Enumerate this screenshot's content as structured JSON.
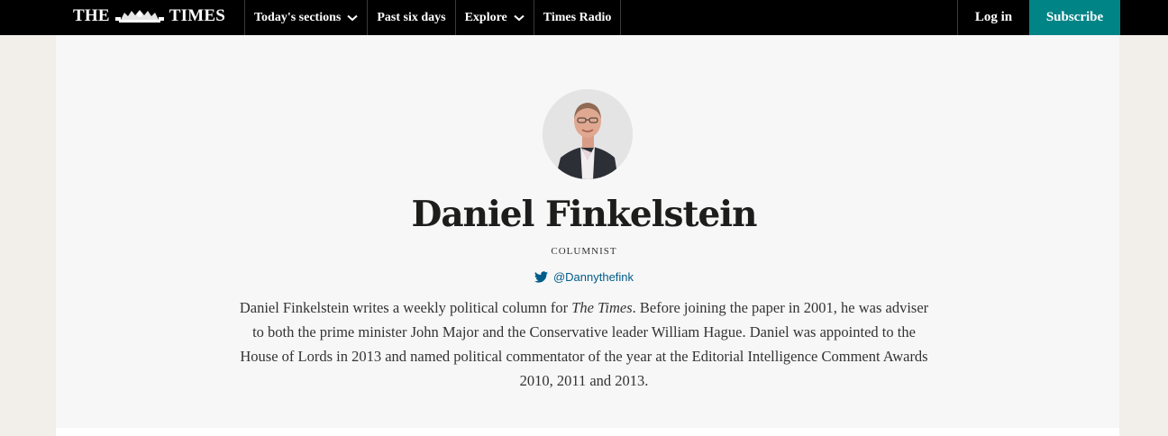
{
  "header": {
    "logo_left": "THE",
    "logo_right": "TIMES",
    "nav": [
      {
        "label": "Today's sections",
        "dropdown": true
      },
      {
        "label": "Past six days",
        "dropdown": false
      },
      {
        "label": "Explore",
        "dropdown": true
      },
      {
        "label": "Times Radio",
        "dropdown": false
      }
    ],
    "login_label": "Log in",
    "subscribe_label": "Subscribe"
  },
  "profile": {
    "name": "Daniel Finkelstein",
    "role": "COLUMNIST",
    "twitter_handle": "@Dannythefink",
    "bio_part1": "Daniel Finkelstein writes a weekly political column for ",
    "bio_publication": "The Times",
    "bio_part2": ". Before joining the paper in 2001, he was adviser to both the prime minister John Major and the Conservative leader William Hague. Daniel was appointed to the House of Lords in 2013 and named political commentator of the year at the Editorial Intelligence Comment Awards 2010, 2011 and 2013."
  },
  "colors": {
    "nav_background": "#000000",
    "subscribe_background": "#008486",
    "twitter_link": "#005c8a",
    "page_background": "#f2eee9"
  },
  "icons": [
    "crest-icon",
    "chevron-down-icon",
    "twitter-icon"
  ]
}
